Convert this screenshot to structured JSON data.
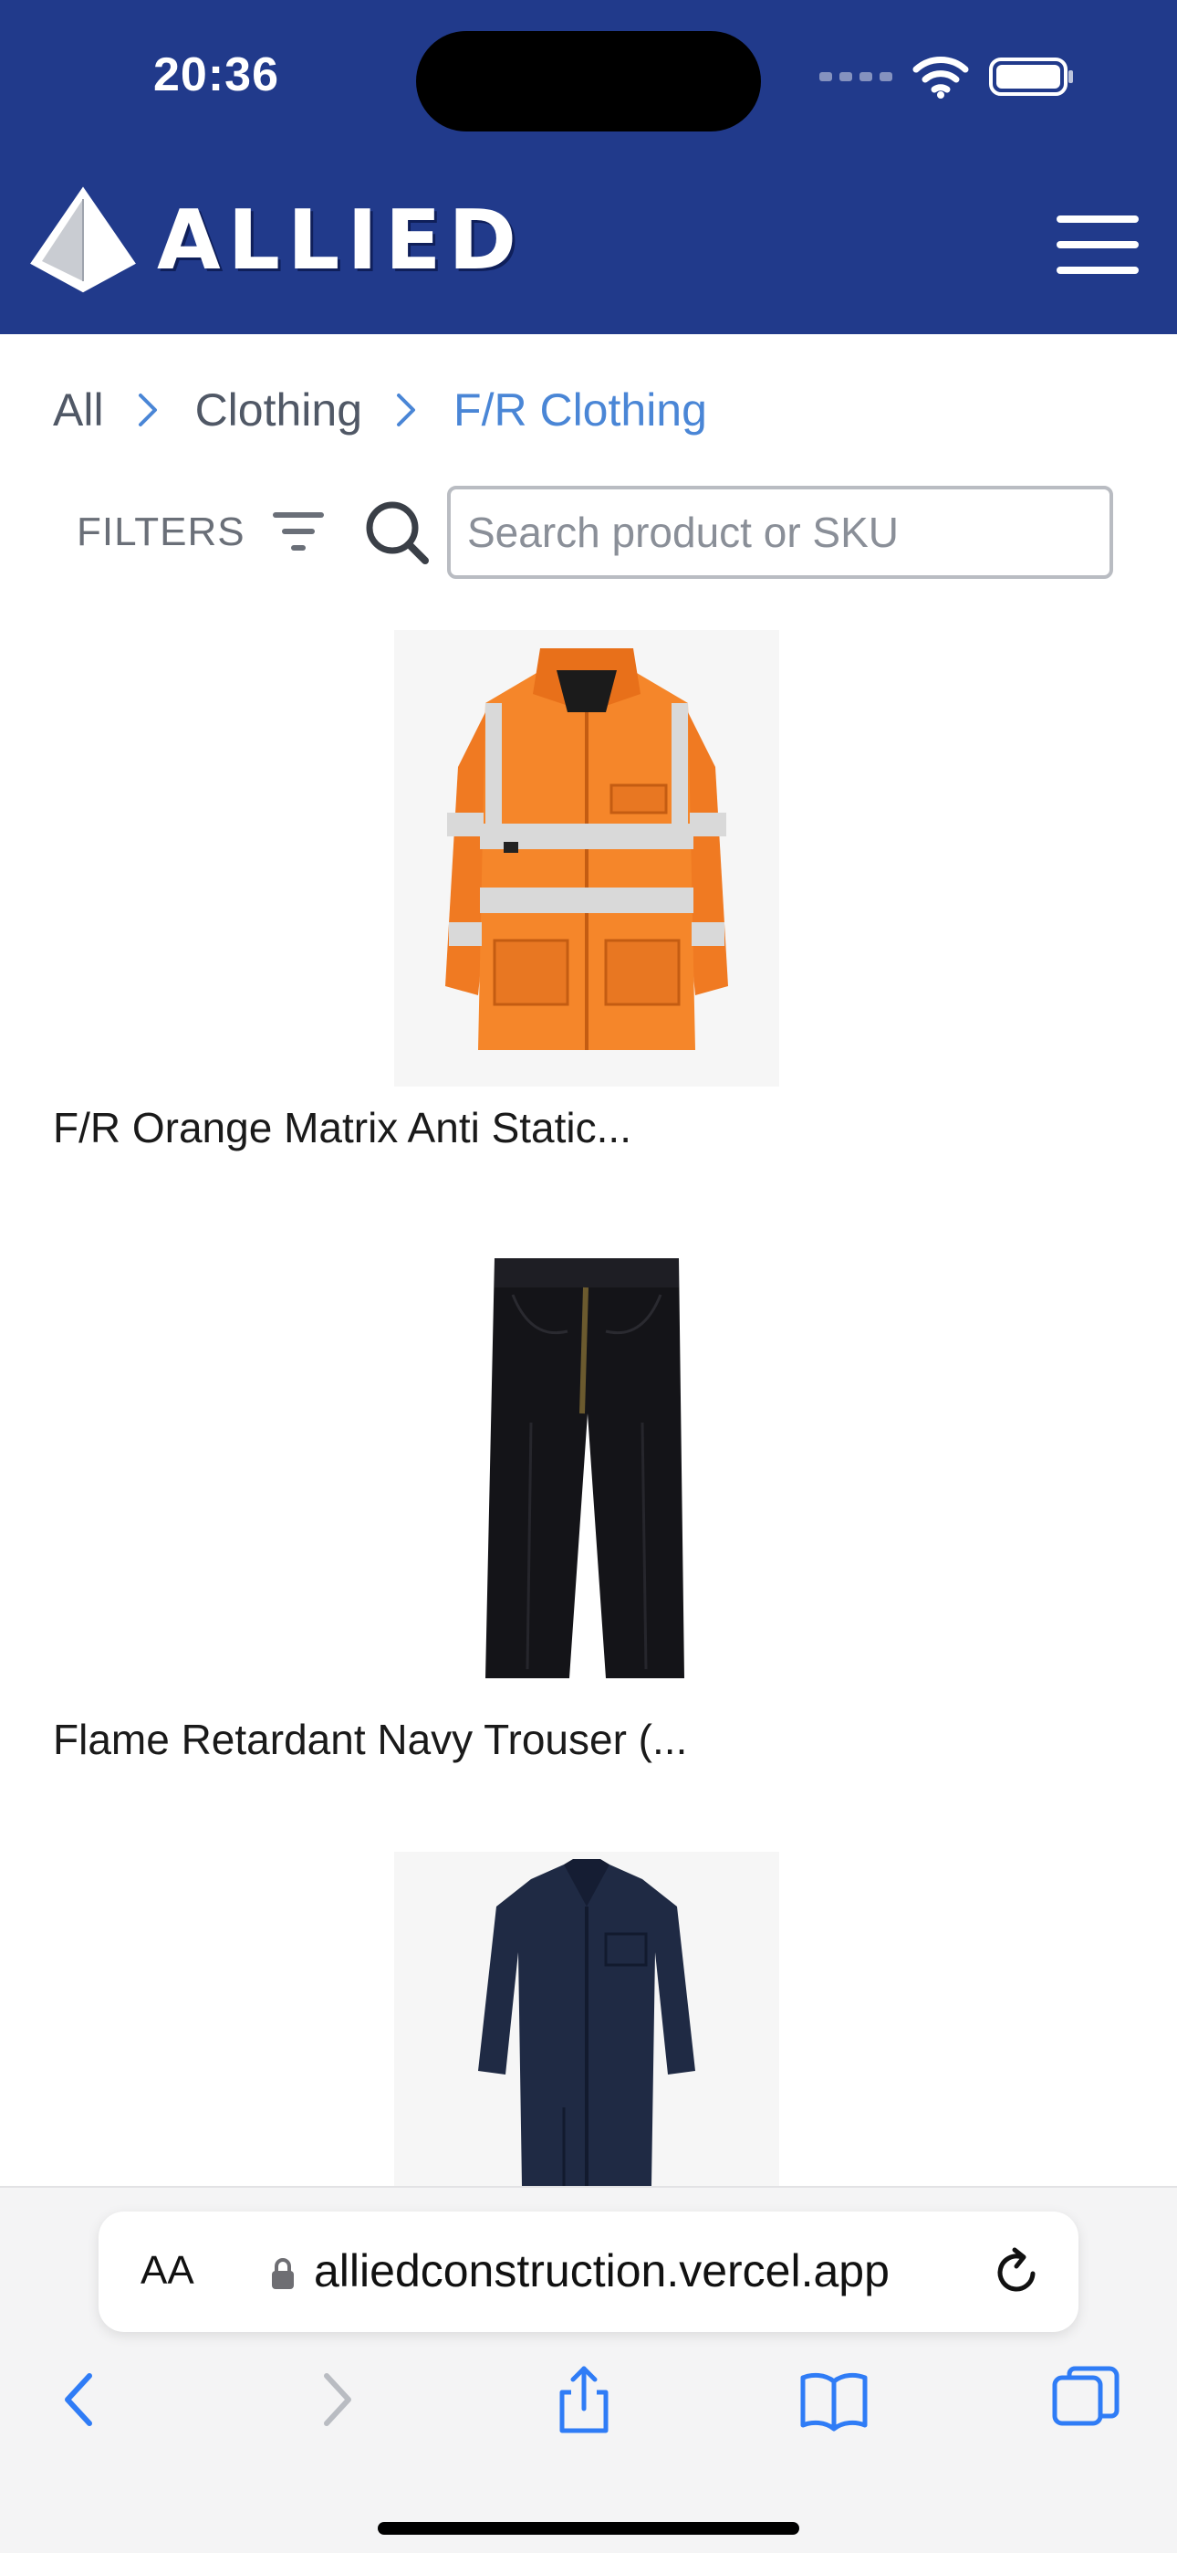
{
  "status_bar": {
    "time": "20:36"
  },
  "header": {
    "brand": "ALLIED",
    "menu_icon": "hamburger-menu-icon",
    "background_color": "#213a8b"
  },
  "breadcrumb": {
    "items": [
      "All",
      "Clothing",
      "F/R Clothing"
    ],
    "current_color": "#4a86d6"
  },
  "toolbar": {
    "filters_label": "FILTERS",
    "search_placeholder": "Search product or SKU"
  },
  "products": [
    {
      "name": "F/R Orange Matrix Anti Static...",
      "image": "orange-hi-vis-jacket"
    },
    {
      "name": "Flame Retardant Navy Trouser (...",
      "image": "navy-trousers"
    },
    {
      "name": "",
      "image": "navy-coverall"
    }
  ],
  "browser": {
    "text_size_label": "AA",
    "url": "alliedconstruction.vercel.app",
    "icons": [
      "back-icon",
      "forward-icon",
      "share-icon",
      "bookmarks-icon",
      "tabs-icon",
      "reload-icon",
      "lock-icon"
    ]
  }
}
